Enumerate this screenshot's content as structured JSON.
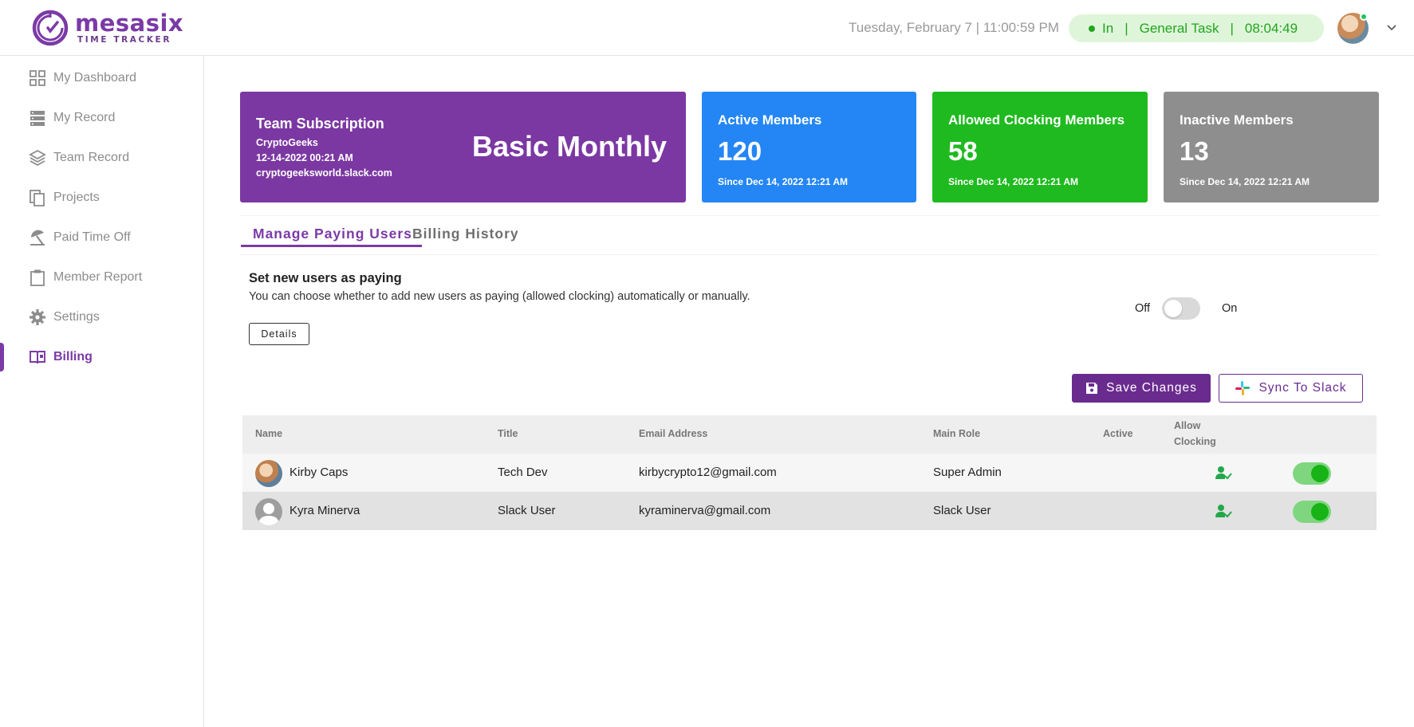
{
  "header": {
    "logo_name": "mesasix",
    "logo_sub": "TIME TRACKER",
    "datetime": "Tuesday, February 7 | 11:00:59 PM",
    "status": "In",
    "task": "General Task",
    "timer": "08:04:49",
    "separator": "|"
  },
  "sidebar": {
    "items": [
      {
        "label": "My Dashboard",
        "icon": "dashboard-icon"
      },
      {
        "label": "My Record",
        "icon": "record-icon"
      },
      {
        "label": "Team Record",
        "icon": "layers-icon"
      },
      {
        "label": "Projects",
        "icon": "copy-icon"
      },
      {
        "label": "Paid Time Off",
        "icon": "umbrella-icon"
      },
      {
        "label": "Member Report",
        "icon": "clipboard-icon"
      },
      {
        "label": "Settings",
        "icon": "gear-icon"
      },
      {
        "label": "Billing",
        "icon": "billing-icon",
        "active": true
      }
    ]
  },
  "cards": {
    "subscription": {
      "title": "Team Subscription",
      "team": "CryptoGeeks",
      "date": "12-14-2022 00:21 AM",
      "workspace": "cryptogeeksworld.slack.com",
      "plan": "Basic Monthly",
      "color": "#7b38a2"
    },
    "active": {
      "title": "Active Members",
      "count": "120",
      "since": "Since Dec 14, 2022 12:21 AM",
      "color": "#2486f5"
    },
    "allowed": {
      "title": "Allowed Clocking Members",
      "count": "58",
      "since": "Since Dec 14, 2022 12:21 AM",
      "color": "#1fba1f"
    },
    "inactive": {
      "title": "Inactive Members",
      "count": "13",
      "since": "Since Dec 14, 2022 12:21 AM",
      "color": "#8e8e8e"
    }
  },
  "tabs": [
    {
      "label": "Manage Paying Users",
      "active": true
    },
    {
      "label": "Billing History",
      "active": false
    }
  ],
  "setting": {
    "title": "Set new users as paying",
    "description": "You can choose whether to add new users as paying (allowed clocking) automatically or manually.",
    "details_label": "Details",
    "off_label": "Off",
    "on_label": "On",
    "toggle_on": false
  },
  "actions": {
    "save_label": "Save Changes",
    "sync_label": "Sync To Slack"
  },
  "table": {
    "headers": {
      "name": "Name",
      "title": "Title",
      "email": "Email Address",
      "role": "Main Role",
      "active": "Active",
      "allow_1": "Allow",
      "allow_2": "Clocking"
    },
    "rows": [
      {
        "name": "Kirby Caps",
        "title": "Tech Dev",
        "email": "kirbycrypto12@gmail.com",
        "role": "Super Admin",
        "active": true,
        "allow_clocking": true
      },
      {
        "name": "Kyra Minerva",
        "title": "Slack User",
        "email": "kyraminerva@gmail.com",
        "role": "Slack User",
        "active": true,
        "allow_clocking": true
      }
    ]
  },
  "colors": {
    "brand": "#7b3aa6",
    "status_green": "#22a51f",
    "toggle_on": "#17b317"
  }
}
